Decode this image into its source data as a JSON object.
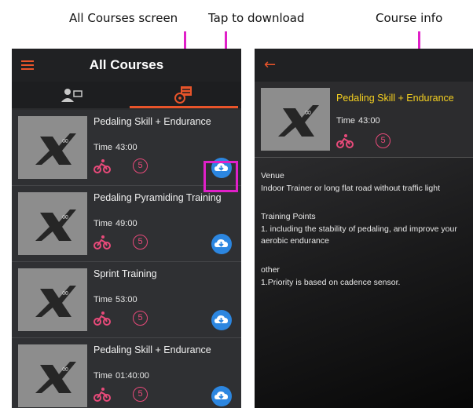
{
  "annotations": {
    "all_courses_screen": "All Courses screen",
    "tap_to_download": "Tap to download",
    "course_info": "Course info"
  },
  "left_screen": {
    "title": "All Courses",
    "tabs": [
      "personal-tab",
      "calendar-tab"
    ],
    "active_tab": 1,
    "courses": [
      {
        "title": "Pedaling Skill + Endurance",
        "time_label": "Time",
        "time": "43:00",
        "level": "5"
      },
      {
        "title": "Pedaling Pyramiding Training",
        "time_label": "Time",
        "time": "49:00",
        "level": "5"
      },
      {
        "title": "Sprint Training",
        "time_label": "Time",
        "time": "53:00",
        "level": "5"
      },
      {
        "title": "Pedaling Skill + Endurance",
        "time_label": "Time",
        "time": "01:40:00",
        "level": "5"
      }
    ]
  },
  "right_screen": {
    "course": {
      "title": "Pedaling Skill + Endurance",
      "time_label": "Time",
      "time": "43:00",
      "level": "5"
    },
    "venue_heading": "Venue",
    "venue_text": "Indoor Trainer or long flat road without traffic light",
    "training_points_heading": "Training Points",
    "training_points_text": "1.  including the stability of pedaling, and improve your aerobic endurance",
    "other_heading": "other",
    "other_text": "1.Priority is based on cadence sensor."
  },
  "colors": {
    "accent": "#e8542a",
    "highlight": "#e020c8",
    "download": "#2c86e0",
    "level": "#e84a7a",
    "title_yellow": "#f5d020"
  }
}
